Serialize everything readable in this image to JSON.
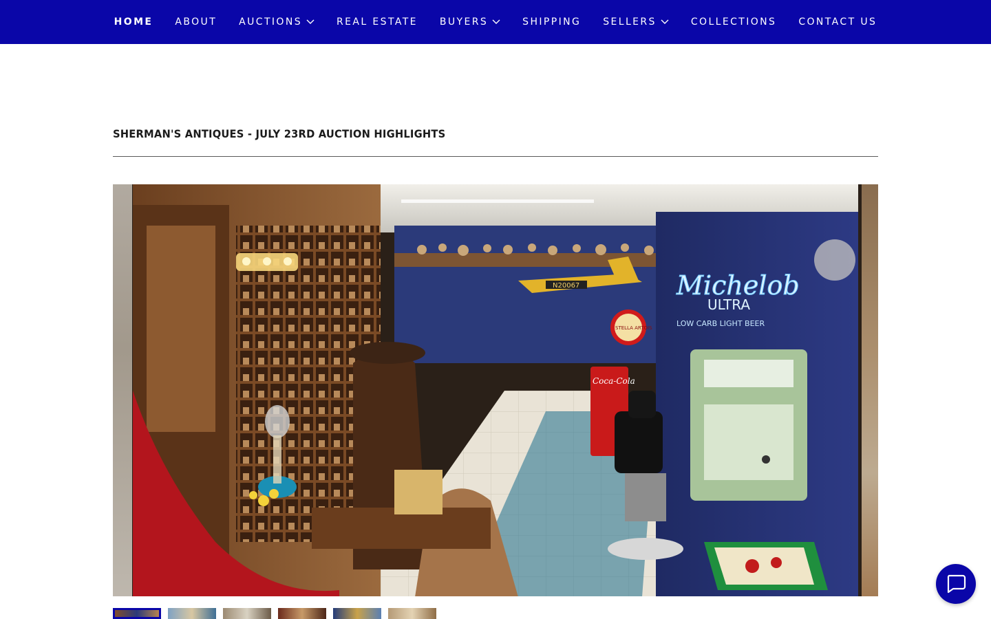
{
  "nav": {
    "items": [
      {
        "label": "HOME",
        "active": true,
        "dropdown": false
      },
      {
        "label": "ABOUT",
        "active": false,
        "dropdown": false
      },
      {
        "label": "AUCTIONS",
        "active": false,
        "dropdown": true
      },
      {
        "label": "REAL ESTATE",
        "active": false,
        "dropdown": false
      },
      {
        "label": "BUYERS",
        "active": false,
        "dropdown": true
      },
      {
        "label": "SHIPPING",
        "active": false,
        "dropdown": false
      },
      {
        "label": "SELLERS",
        "active": false,
        "dropdown": true
      },
      {
        "label": "COLLECTIONS",
        "active": false,
        "dropdown": false
      },
      {
        "label": "CONTACT US",
        "active": false,
        "dropdown": false
      }
    ]
  },
  "main": {
    "heading": "SHERMAN'S ANTIQUES - JULY 23RD AUCTION HIGHLIGHTS"
  },
  "gallery": {
    "photo_signs": {
      "neon_brand": "Michelob",
      "neon_line2": "ULTRA",
      "neon_line3": "LOW CARB LIGHT BEER",
      "plane_tail": "N20067",
      "round_sign": "STELLA ARTOIS",
      "cola_sign": "Coca-Cola"
    },
    "thumbnail_count": 6,
    "active_index": 0
  },
  "icons": {
    "dropdown": "chevron-down-icon",
    "chat": "chat-bubble-icon"
  },
  "colors": {
    "nav_bg": "#0a06a8",
    "nav_text": "#ffffff",
    "accent": "#0a06a8",
    "heading": "#1b1b1b"
  }
}
